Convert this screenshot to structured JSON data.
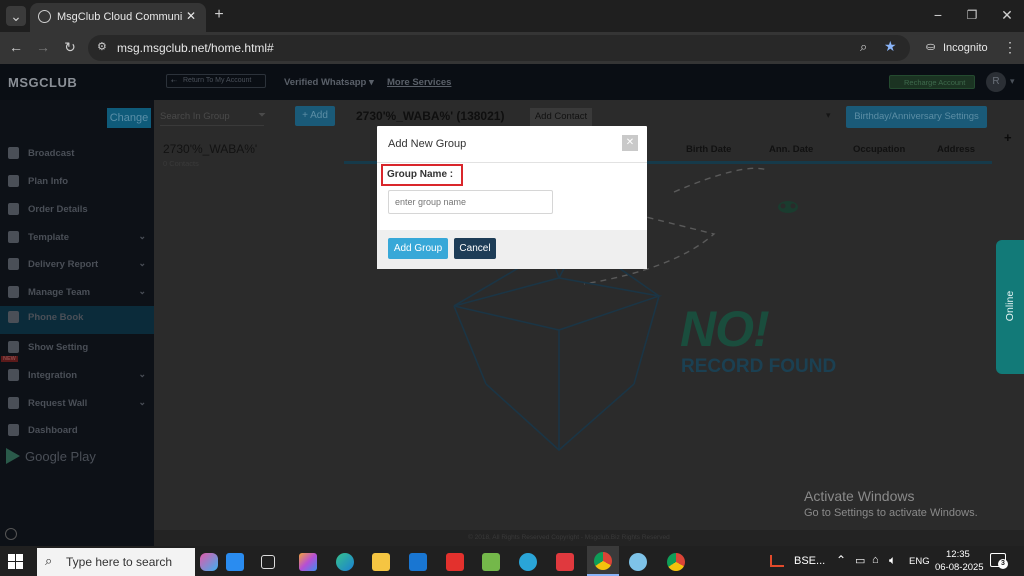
{
  "browser": {
    "tab_title": "MsgClub Cloud Communication",
    "url": "msg.msgclub.net/home.html#",
    "profile_label": "Incognito"
  },
  "app": {
    "logo": "MSGCLUB",
    "nav": {
      "return_label": "Return To My Account",
      "verified_whatsapp": "Verified Whatsapp",
      "more_services": "More Services",
      "recharge": "Recharge Account",
      "avatar_letter": "R"
    },
    "sidebar": {
      "change_label": "Change",
      "items": [
        {
          "label": "Broadcast",
          "has_chevron": false
        },
        {
          "label": "Plan Info",
          "has_chevron": false
        },
        {
          "label": "Order Details",
          "has_chevron": false
        },
        {
          "label": "Template",
          "has_chevron": true
        },
        {
          "label": "Delivery Report",
          "has_chevron": true
        },
        {
          "label": "Manage Team",
          "has_chevron": true
        },
        {
          "label": "Phone Book",
          "has_chevron": false
        },
        {
          "label": "Show Setting",
          "has_chevron": false
        },
        {
          "label": "Integration",
          "has_chevron": true
        },
        {
          "label": "Request Wall",
          "has_chevron": true
        },
        {
          "label": "Dashboard",
          "has_chevron": false
        }
      ],
      "new_badge": "NEW",
      "google_play": "Google Play"
    },
    "groups": {
      "search_placeholder": "Search In Group",
      "add_label": "+ Add",
      "group_title": "2730'%_WABA%' (138021)",
      "add_contact": "Add Contact",
      "birthday_settings": "Birthday/Anniversary Settings",
      "list_item_name": "2730'%_WABA%'",
      "list_item_count": "0 Contacts",
      "columns": [
        "Birth Date",
        "Ann. Date",
        "Occupation",
        "Address"
      ],
      "no_record_big": "NO!",
      "no_record_sub": "RECORD FOUND"
    },
    "online_tab": "Online",
    "footer": "© 2018, All Rights Reserved Copyright - Msgclub.Biz Rights Reserved"
  },
  "modal": {
    "title": "Add New Group",
    "close_icon": "close-icon",
    "field_label": "Group Name :",
    "placeholder": "enter group name",
    "value": "",
    "add_button": "Add Group",
    "cancel_button": "Cancel"
  },
  "watermark": {
    "line1": "Activate Windows",
    "line2": "Go to Settings to activate Windows."
  },
  "taskbar": {
    "search_placeholder": "Type here to search",
    "stock": "BSE...",
    "language": "ENG",
    "time": "12:35",
    "date": "06-08-2025",
    "notif_count": "3"
  },
  "colors": {
    "accent_blue": "#38a8d8",
    "dark_navy": "#1e3d57",
    "highlight_red": "#d9262b",
    "brand_green": "#1aa68a"
  }
}
